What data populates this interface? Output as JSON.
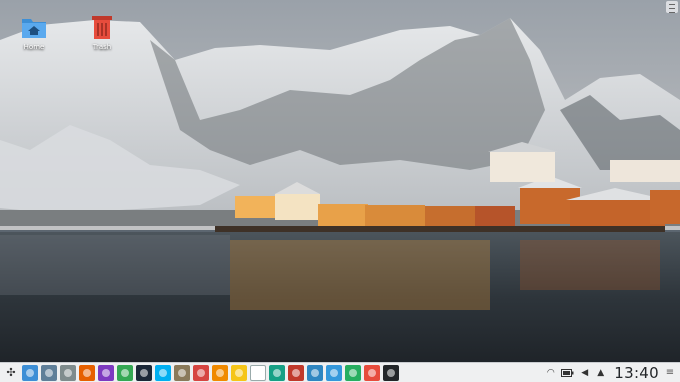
{
  "desktop": {
    "icons": [
      {
        "label": "Home",
        "icon": "home-folder-icon"
      },
      {
        "label": "Trash",
        "icon": "trash-icon"
      }
    ]
  },
  "panel": {
    "launcher_icon": "application-launcher-icon",
    "tasks": [
      {
        "icon": "desktop-icon",
        "color": "#3d8fd6"
      },
      {
        "icon": "file-manager-icon",
        "color": "#5f7f99"
      },
      {
        "icon": "archive-icon",
        "color": "#7f8c8d"
      },
      {
        "icon": "firefox-icon",
        "color": "#e66000"
      },
      {
        "icon": "firefox-nightly-icon",
        "color": "#7d3ac0"
      },
      {
        "icon": "chrome-icon",
        "color": "#34a853"
      },
      {
        "icon": "steam-icon",
        "color": "#1b2838"
      },
      {
        "icon": "skype-icon",
        "color": "#00aff0"
      },
      {
        "icon": "gimp-icon",
        "color": "#8a7a5a"
      },
      {
        "icon": "screenshot-icon",
        "color": "#d64541"
      },
      {
        "icon": "vlc-icon",
        "color": "#f08a00"
      },
      {
        "icon": "banana-icon",
        "color": "#f5c518"
      },
      {
        "icon": "text-document-icon",
        "color": "#ffffff"
      },
      {
        "icon": "ebook-icon",
        "color": "#16a085"
      },
      {
        "icon": "document-viewer-icon",
        "color": "#c0392b"
      },
      {
        "icon": "system-monitor-icon",
        "color": "#2e86c1"
      },
      {
        "icon": "activity-monitor-icon",
        "color": "#3498db"
      },
      {
        "icon": "image-viewer-icon",
        "color": "#27ae60"
      },
      {
        "icon": "remote-desktop-icon",
        "color": "#e74c3c"
      },
      {
        "icon": "terminal-icon",
        "color": "#232629"
      }
    ],
    "tray": {
      "icons": [
        "network-wifi-icon",
        "battery-icon",
        "volume-icon",
        "expand-tray-icon"
      ],
      "clock": "13:40"
    }
  }
}
